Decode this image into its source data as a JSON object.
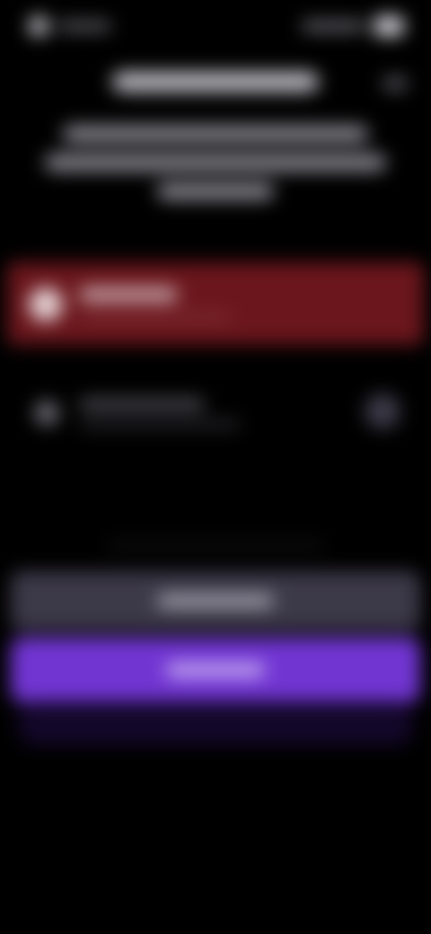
{
  "theme": {
    "background": "#000000",
    "accent_primary": "#7135d2",
    "accent_secondary": "#3c3948",
    "selected_option": "#6a161c"
  },
  "status_bar": {
    "left_icons": [
      "signal-icon"
    ],
    "right_icons": [
      "battery-icon"
    ]
  },
  "header": {
    "close_icon": "close-icon"
  },
  "options": [
    {
      "icon": "option-icon",
      "selected": true
    },
    {
      "icon": "option-icon",
      "selected": false,
      "indicator_icon": "radio-icon"
    }
  ],
  "buttons": {
    "secondary_icon": "secondary-action",
    "primary_icon": "primary-action"
  }
}
